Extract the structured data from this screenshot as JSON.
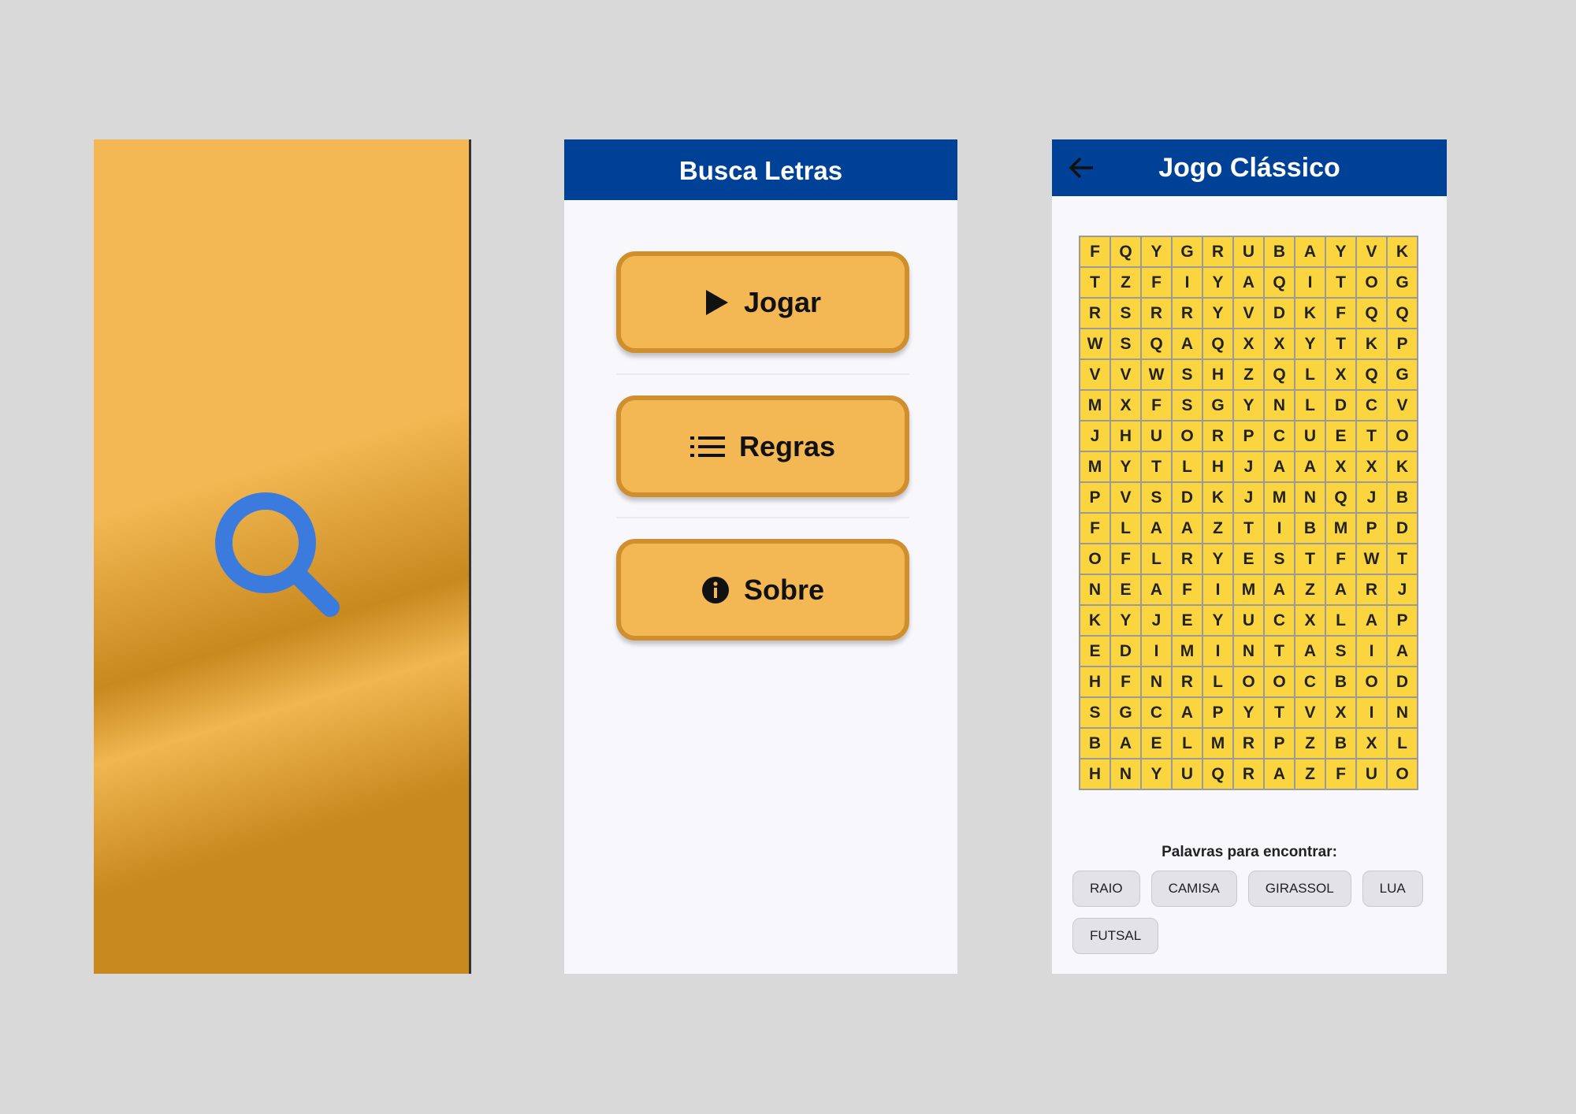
{
  "colors": {
    "background": "#d9d9d9",
    "appbar": "#004198",
    "button_fill": "#f3b853",
    "button_border": "#cf8f2f",
    "grid_cell": "#fad53f",
    "splash_icon": "#3a7bdd"
  },
  "splash": {
    "icon": "search-icon"
  },
  "menu": {
    "title": "Busca Letras",
    "buttons": [
      {
        "label": "Jogar",
        "icon": "play-icon"
      },
      {
        "label": "Regras",
        "icon": "list-icon"
      },
      {
        "label": "Sobre",
        "icon": "info-icon"
      }
    ]
  },
  "game": {
    "back_icon": "arrow-left-icon",
    "title": "Jogo Clássico",
    "grid": [
      [
        "F",
        "Q",
        "Y",
        "G",
        "R",
        "U",
        "B",
        "A",
        "Y",
        "V",
        "K"
      ],
      [
        "T",
        "Z",
        "F",
        "I",
        "Y",
        "A",
        "Q",
        "I",
        "T",
        "O",
        "G"
      ],
      [
        "R",
        "S",
        "R",
        "R",
        "Y",
        "V",
        "D",
        "K",
        "F",
        "Q",
        "Q"
      ],
      [
        "W",
        "S",
        "Q",
        "A",
        "Q",
        "X",
        "X",
        "Y",
        "T",
        "K",
        "P"
      ],
      [
        "V",
        "V",
        "W",
        "S",
        "H",
        "Z",
        "Q",
        "L",
        "X",
        "Q",
        "G"
      ],
      [
        "M",
        "X",
        "F",
        "S",
        "G",
        "Y",
        "N",
        "L",
        "D",
        "C",
        "V"
      ],
      [
        "J",
        "H",
        "U",
        "O",
        "R",
        "P",
        "C",
        "U",
        "E",
        "T",
        "O"
      ],
      [
        "M",
        "Y",
        "T",
        "L",
        "H",
        "J",
        "A",
        "A",
        "X",
        "X",
        "K"
      ],
      [
        "P",
        "V",
        "S",
        "D",
        "K",
        "J",
        "M",
        "N",
        "Q",
        "J",
        "B"
      ],
      [
        "F",
        "L",
        "A",
        "A",
        "Z",
        "T",
        "I",
        "B",
        "M",
        "P",
        "D"
      ],
      [
        "O",
        "F",
        "L",
        "R",
        "Y",
        "E",
        "S",
        "T",
        "F",
        "W",
        "T"
      ],
      [
        "N",
        "E",
        "A",
        "F",
        "I",
        "M",
        "A",
        "Z",
        "A",
        "R",
        "J"
      ],
      [
        "K",
        "Y",
        "J",
        "E",
        "Y",
        "U",
        "C",
        "X",
        "L",
        "A",
        "P"
      ],
      [
        "E",
        "D",
        "I",
        "M",
        "I",
        "N",
        "T",
        "A",
        "S",
        "I",
        "A"
      ],
      [
        "H",
        "F",
        "N",
        "R",
        "L",
        "O",
        "O",
        "C",
        "B",
        "O",
        "D"
      ],
      [
        "S",
        "G",
        "C",
        "A",
        "P",
        "Y",
        "T",
        "V",
        "X",
        "I",
        "N"
      ],
      [
        "B",
        "A",
        "E",
        "L",
        "M",
        "R",
        "P",
        "Z",
        "B",
        "X",
        "L"
      ],
      [
        "H",
        "N",
        "Y",
        "U",
        "Q",
        "R",
        "A",
        "Z",
        "F",
        "U",
        "O"
      ]
    ],
    "words_title": "Palavras para encontrar:",
    "words": [
      "RAIO",
      "CAMISA",
      "GIRASSOL",
      "LUA",
      "FUTSAL"
    ]
  }
}
